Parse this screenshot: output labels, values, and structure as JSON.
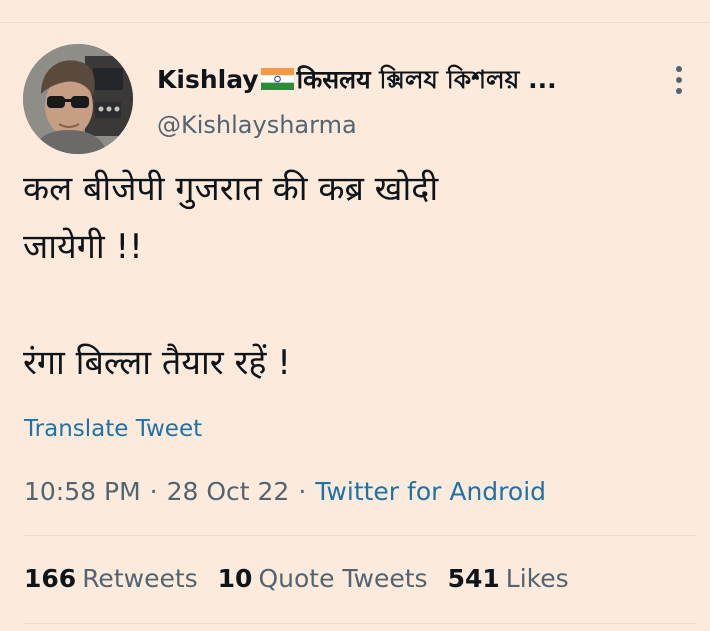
{
  "author": {
    "name": "Kishlay",
    "name_suffix": "किसलय ক্সিলয কিশলয় ...",
    "flag_icon": "india-flag-icon",
    "handle": "@Kishlaysharma"
  },
  "tweet": {
    "lines": [
      "कल बीजेपी गुजरात की कब्र खोदी",
      "जायेगी !!",
      "",
      "रंगा बिल्ला तैयार रहें !"
    ],
    "translate_label": "Translate Tweet",
    "time": "10:58 PM",
    "date": "28 Oct 22",
    "source": "Twitter for Android",
    "separator": "·"
  },
  "stats": {
    "retweets_count": "166",
    "retweets_label": "Retweets",
    "quote_tweets_count": "10",
    "quote_tweets_label": "Quote Tweets",
    "likes_count": "541",
    "likes_label": "Likes"
  },
  "colors": {
    "background": "#fcebdc",
    "text_primary": "#0f1419",
    "text_secondary": "#536471",
    "link": "#1d72a8"
  },
  "icons": {
    "more": "more-vertical-icon",
    "flag": "india-flag-icon"
  }
}
